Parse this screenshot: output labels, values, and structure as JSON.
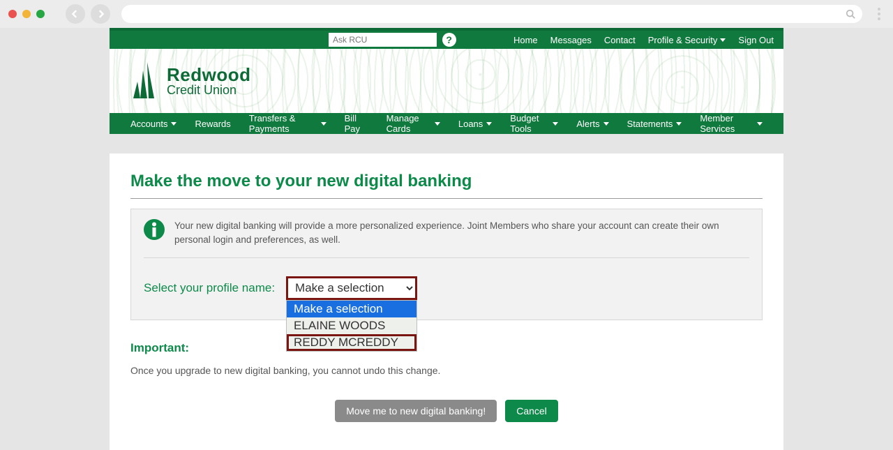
{
  "browser": {
    "search_icon": "search"
  },
  "topbar": {
    "ask_placeholder": "Ask RCU",
    "links": {
      "home": "Home",
      "messages": "Messages",
      "contact": "Contact",
      "profile": "Profile & Security",
      "signout": "Sign Out"
    }
  },
  "logo": {
    "line1": "Redwood",
    "line2": "Credit Union"
  },
  "mainnav": {
    "accounts": "Accounts",
    "rewards": "Rewards",
    "transfers": "Transfers & Payments",
    "billpay": "Bill Pay",
    "cards": "Manage Cards",
    "loans": "Loans",
    "budget": "Budget Tools",
    "alerts": "Alerts",
    "statements": "Statements",
    "member": "Member Services"
  },
  "main": {
    "title": "Make the move to your new digital banking",
    "info_text": "Your new digital banking will provide a more personalized experience. Joint Members who share your account can create their own personal login and preferences, as well.",
    "select_label": "Select your profile name:",
    "select_placeholder": "Make a selection",
    "options": [
      "Make a selection",
      "ELAINE WOODS",
      "REDDY MCREDDY"
    ],
    "important_heading": "Important:",
    "important_text": "Once you upgrade to new digital banking, you cannot undo this change.",
    "move_btn": "Move me to new digital banking!",
    "cancel_btn": "Cancel"
  }
}
